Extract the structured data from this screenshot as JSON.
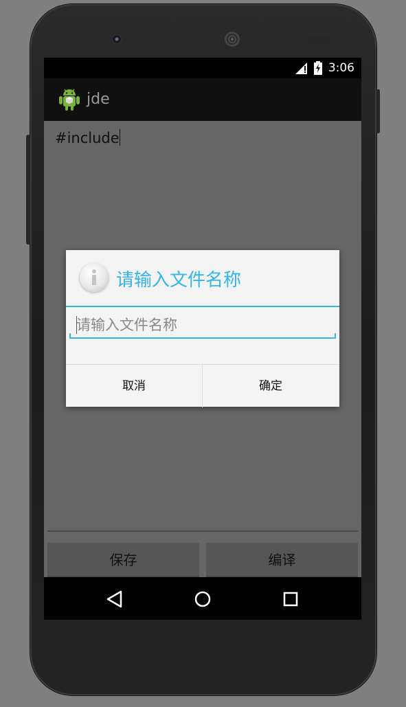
{
  "status_bar": {
    "time": "3:06",
    "signal_icon": "signal-icon",
    "battery_icon": "battery-icon"
  },
  "action_bar": {
    "app_title": "jde",
    "app_icon": "android-icon"
  },
  "editor": {
    "text": "#include"
  },
  "buttons": {
    "save_label": "保存",
    "compile_label": "编译"
  },
  "dialog": {
    "title": "请输入文件名称",
    "icon": "info-icon",
    "input_placeholder": "请输入文件名称",
    "input_value": "",
    "cancel_label": "取消",
    "confirm_label": "确定"
  },
  "nav_bar": {
    "back_icon": "back-icon",
    "home_icon": "home-icon",
    "recents_icon": "recents-icon"
  },
  "colors": {
    "accent": "#33b5e5",
    "content_bg": "#666666",
    "dialog_bg": "#f3f3f3"
  }
}
